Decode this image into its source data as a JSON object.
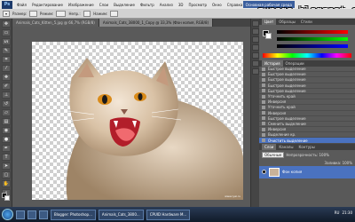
{
  "menu": {
    "app_icon": "Ps",
    "items": [
      "Файл",
      "Редактирование",
      "Изображение",
      "Слои",
      "Выделение",
      "Фильтр",
      "Анализ",
      "3D",
      "Просмотр",
      "Окно",
      "Справка"
    ],
    "workspace_label": "Основная рабочая среда"
  },
  "options": {
    "labels": [
      "Размер:",
      "Режим:",
      "Непр.:",
      "Нажим:"
    ]
  },
  "tabs": [
    {
      "label": "Animals_Cats_Kitten_5.jpg @ 66,7% (RGB/8)"
    },
    {
      "label": "Animals_Cats_38000_1_Copy @ 33,3% (Фон копия, RGB/8)"
    }
  ],
  "canvas": {
    "watermark": "www.ryai.ru"
  },
  "blog_title": "sunego.blogspot.com",
  "panels": {
    "color_tabs": [
      "Цвет",
      "Образцы",
      "Стили"
    ],
    "history_tabs": [
      "История",
      "Операции"
    ],
    "history": [
      "Быстрое выделение",
      "Быстрое выделение",
      "Быстрое выделение",
      "Быстрое выделение",
      "Быстрое выделение",
      "Уточнить край",
      "Инверсия",
      "Уточнить край",
      "Инверсия",
      "Быстрое выделение",
      "Сменить выделение",
      "Инверсия",
      "Выделение кр.",
      "Очистить выделение"
    ],
    "layers_tabs": [
      "Слои",
      "Каналы",
      "Контуры"
    ],
    "layer_mode": "Обычные",
    "opacity_label": "Непрозрачность: 100%",
    "fill_label": "Заливка: 100%",
    "layer_name": "Фон копия"
  },
  "taskbar": {
    "items": [
      "Blogger: Photoshop...",
      "Animals_Cats_3800...",
      "CPUID Hardware M..."
    ],
    "tray_lang": "RU",
    "tray_time": "21:30"
  }
}
